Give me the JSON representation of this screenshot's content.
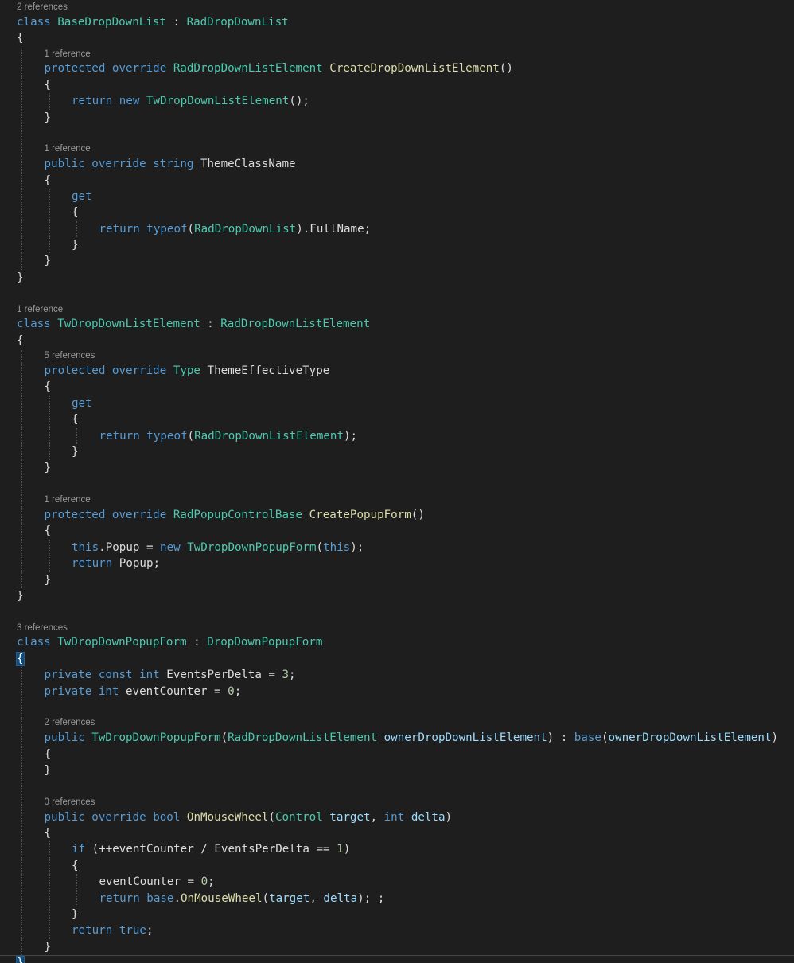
{
  "editor": {
    "language": "C#",
    "colors": {
      "background": "#1e1e1e",
      "keyword": "#569cd6",
      "type": "#4ec9b0",
      "method": "#dcdcaa",
      "parameter": "#9cdcfe",
      "number": "#b5cea8",
      "plain": "#dcdcdc",
      "codelens": "#999999"
    },
    "lines": [
      {
        "kind": "lens",
        "indent": 0,
        "text": "2 references"
      },
      {
        "kind": "code",
        "indent": 0,
        "tokens": [
          [
            "kw",
            "class"
          ],
          [
            "pl",
            " "
          ],
          [
            "ty",
            "BaseDropDownList"
          ],
          [
            "pl",
            " : "
          ],
          [
            "ty",
            "RadDropDownList"
          ]
        ]
      },
      {
        "kind": "code",
        "indent": 0,
        "tokens": [
          [
            "pl",
            "{"
          ]
        ]
      },
      {
        "kind": "lens",
        "indent": 1,
        "text": "1 reference"
      },
      {
        "kind": "code",
        "indent": 1,
        "tokens": [
          [
            "kw",
            "protected"
          ],
          [
            "pl",
            " "
          ],
          [
            "kw",
            "override"
          ],
          [
            "pl",
            " "
          ],
          [
            "ty",
            "RadDropDownListElement"
          ],
          [
            "pl",
            " "
          ],
          [
            "fn",
            "CreateDropDownListElement"
          ],
          [
            "pl",
            "()"
          ]
        ]
      },
      {
        "kind": "code",
        "indent": 1,
        "tokens": [
          [
            "pl",
            "{"
          ]
        ]
      },
      {
        "kind": "code",
        "indent": 2,
        "tokens": [
          [
            "kw",
            "return"
          ],
          [
            "pl",
            " "
          ],
          [
            "kw",
            "new"
          ],
          [
            "pl",
            " "
          ],
          [
            "ty",
            "TwDropDownListElement"
          ],
          [
            "pl",
            "();"
          ]
        ]
      },
      {
        "kind": "code",
        "indent": 1,
        "tokens": [
          [
            "pl",
            "}"
          ]
        ]
      },
      {
        "kind": "blank"
      },
      {
        "kind": "lens",
        "indent": 1,
        "text": "1 reference"
      },
      {
        "kind": "code",
        "indent": 1,
        "tokens": [
          [
            "kw",
            "public"
          ],
          [
            "pl",
            " "
          ],
          [
            "kw",
            "override"
          ],
          [
            "pl",
            " "
          ],
          [
            "kw",
            "string"
          ],
          [
            "pl",
            " ThemeClassName"
          ]
        ]
      },
      {
        "kind": "code",
        "indent": 1,
        "tokens": [
          [
            "pl",
            "{"
          ]
        ]
      },
      {
        "kind": "code",
        "indent": 2,
        "tokens": [
          [
            "kw",
            "get"
          ]
        ]
      },
      {
        "kind": "code",
        "indent": 2,
        "tokens": [
          [
            "pl",
            "{"
          ]
        ]
      },
      {
        "kind": "code",
        "indent": 3,
        "tokens": [
          [
            "kw",
            "return"
          ],
          [
            "pl",
            " "
          ],
          [
            "kw",
            "typeof"
          ],
          [
            "pl",
            "("
          ],
          [
            "ty",
            "RadDropDownList"
          ],
          [
            "pl",
            ").FullName;"
          ]
        ]
      },
      {
        "kind": "code",
        "indent": 2,
        "tokens": [
          [
            "pl",
            "}"
          ]
        ]
      },
      {
        "kind": "code",
        "indent": 1,
        "tokens": [
          [
            "pl",
            "}"
          ]
        ]
      },
      {
        "kind": "code",
        "indent": 0,
        "tokens": [
          [
            "pl",
            "}"
          ]
        ]
      },
      {
        "kind": "blank"
      },
      {
        "kind": "lens",
        "indent": 0,
        "text": "1 reference"
      },
      {
        "kind": "code",
        "indent": 0,
        "tokens": [
          [
            "kw",
            "class"
          ],
          [
            "pl",
            " "
          ],
          [
            "ty",
            "TwDropDownListElement"
          ],
          [
            "pl",
            " : "
          ],
          [
            "ty",
            "RadDropDownListElement"
          ]
        ]
      },
      {
        "kind": "code",
        "indent": 0,
        "tokens": [
          [
            "pl",
            "{"
          ]
        ]
      },
      {
        "kind": "lens",
        "indent": 1,
        "text": "5 references"
      },
      {
        "kind": "code",
        "indent": 1,
        "tokens": [
          [
            "kw",
            "protected"
          ],
          [
            "pl",
            " "
          ],
          [
            "kw",
            "override"
          ],
          [
            "pl",
            " "
          ],
          [
            "ty",
            "Type"
          ],
          [
            "pl",
            " ThemeEffectiveType"
          ]
        ]
      },
      {
        "kind": "code",
        "indent": 1,
        "tokens": [
          [
            "pl",
            "{"
          ]
        ]
      },
      {
        "kind": "code",
        "indent": 2,
        "tokens": [
          [
            "kw",
            "get"
          ]
        ]
      },
      {
        "kind": "code",
        "indent": 2,
        "tokens": [
          [
            "pl",
            "{"
          ]
        ]
      },
      {
        "kind": "code",
        "indent": 3,
        "tokens": [
          [
            "kw",
            "return"
          ],
          [
            "pl",
            " "
          ],
          [
            "kw",
            "typeof"
          ],
          [
            "pl",
            "("
          ],
          [
            "ty",
            "RadDropDownListElement"
          ],
          [
            "pl",
            ");"
          ]
        ]
      },
      {
        "kind": "code",
        "indent": 2,
        "tokens": [
          [
            "pl",
            "}"
          ]
        ]
      },
      {
        "kind": "code",
        "indent": 1,
        "tokens": [
          [
            "pl",
            "}"
          ]
        ]
      },
      {
        "kind": "blank"
      },
      {
        "kind": "lens",
        "indent": 1,
        "text": "1 reference"
      },
      {
        "kind": "code",
        "indent": 1,
        "tokens": [
          [
            "kw",
            "protected"
          ],
          [
            "pl",
            " "
          ],
          [
            "kw",
            "override"
          ],
          [
            "pl",
            " "
          ],
          [
            "ty",
            "RadPopupControlBase"
          ],
          [
            "pl",
            " "
          ],
          [
            "fn",
            "CreatePopupForm"
          ],
          [
            "pl",
            "()"
          ]
        ]
      },
      {
        "kind": "code",
        "indent": 1,
        "tokens": [
          [
            "pl",
            "{"
          ]
        ]
      },
      {
        "kind": "code",
        "indent": 2,
        "tokens": [
          [
            "kw",
            "this"
          ],
          [
            "pl",
            ".Popup = "
          ],
          [
            "kw",
            "new"
          ],
          [
            "pl",
            " "
          ],
          [
            "ty",
            "TwDropDownPopupForm"
          ],
          [
            "pl",
            "("
          ],
          [
            "kw",
            "this"
          ],
          [
            "pl",
            ");"
          ]
        ]
      },
      {
        "kind": "code",
        "indent": 2,
        "tokens": [
          [
            "kw",
            "return"
          ],
          [
            "pl",
            " Popup;"
          ]
        ]
      },
      {
        "kind": "code",
        "indent": 1,
        "tokens": [
          [
            "pl",
            "}"
          ]
        ]
      },
      {
        "kind": "code",
        "indent": 0,
        "tokens": [
          [
            "pl",
            "}"
          ]
        ]
      },
      {
        "kind": "blank"
      },
      {
        "kind": "lens",
        "indent": 0,
        "text": "3 references"
      },
      {
        "kind": "code",
        "indent": 0,
        "tokens": [
          [
            "kw",
            "class"
          ],
          [
            "pl",
            " "
          ],
          [
            "ty",
            "TwDropDownPopupForm"
          ],
          [
            "pl",
            " : "
          ],
          [
            "ty",
            "DropDownPopupForm"
          ]
        ]
      },
      {
        "kind": "code",
        "indent": 0,
        "brace": true,
        "tokens": [
          [
            "pl",
            "{"
          ]
        ]
      },
      {
        "kind": "code",
        "indent": 1,
        "tokens": [
          [
            "kw",
            "private"
          ],
          [
            "pl",
            " "
          ],
          [
            "kw",
            "const"
          ],
          [
            "pl",
            " "
          ],
          [
            "kw",
            "int"
          ],
          [
            "pl",
            " EventsPerDelta = "
          ],
          [
            "nm",
            "3"
          ],
          [
            "pl",
            ";"
          ]
        ]
      },
      {
        "kind": "code",
        "indent": 1,
        "tokens": [
          [
            "kw",
            "private"
          ],
          [
            "pl",
            " "
          ],
          [
            "kw",
            "int"
          ],
          [
            "pl",
            " eventCounter = "
          ],
          [
            "nm",
            "0"
          ],
          [
            "pl",
            ";"
          ]
        ]
      },
      {
        "kind": "blank"
      },
      {
        "kind": "lens",
        "indent": 1,
        "text": "2 references"
      },
      {
        "kind": "code",
        "indent": 1,
        "tokens": [
          [
            "kw",
            "public"
          ],
          [
            "pl",
            " "
          ],
          [
            "ty",
            "TwDropDownPopupForm"
          ],
          [
            "pl",
            "("
          ],
          [
            "ty",
            "RadDropDownListElement"
          ],
          [
            "pl",
            " "
          ],
          [
            "pr",
            "ownerDropDownListElement"
          ],
          [
            "pl",
            ") : "
          ],
          [
            "kw",
            "base"
          ],
          [
            "pl",
            "("
          ],
          [
            "pr",
            "ownerDropDownListElement"
          ],
          [
            "pl",
            ")"
          ]
        ]
      },
      {
        "kind": "code",
        "indent": 1,
        "tokens": [
          [
            "pl",
            "{"
          ]
        ]
      },
      {
        "kind": "code",
        "indent": 1,
        "tokens": [
          [
            "pl",
            "}"
          ]
        ]
      },
      {
        "kind": "blank"
      },
      {
        "kind": "lens",
        "indent": 1,
        "text": "0 references"
      },
      {
        "kind": "code",
        "indent": 1,
        "tokens": [
          [
            "kw",
            "public"
          ],
          [
            "pl",
            " "
          ],
          [
            "kw",
            "override"
          ],
          [
            "pl",
            " "
          ],
          [
            "kw",
            "bool"
          ],
          [
            "pl",
            " "
          ],
          [
            "fn",
            "OnMouseWheel"
          ],
          [
            "pl",
            "("
          ],
          [
            "ty",
            "Control"
          ],
          [
            "pl",
            " "
          ],
          [
            "pr",
            "target"
          ],
          [
            "pl",
            ", "
          ],
          [
            "kw",
            "int"
          ],
          [
            "pl",
            " "
          ],
          [
            "pr",
            "delta"
          ],
          [
            "pl",
            ")"
          ]
        ]
      },
      {
        "kind": "code",
        "indent": 1,
        "tokens": [
          [
            "pl",
            "{"
          ]
        ]
      },
      {
        "kind": "code",
        "indent": 2,
        "tokens": [
          [
            "kw",
            "if"
          ],
          [
            "pl",
            " (++eventCounter / EventsPerDelta == "
          ],
          [
            "nm",
            "1"
          ],
          [
            "pl",
            ")"
          ]
        ]
      },
      {
        "kind": "code",
        "indent": 2,
        "tokens": [
          [
            "pl",
            "{"
          ]
        ]
      },
      {
        "kind": "code",
        "indent": 3,
        "tokens": [
          [
            "pl",
            "eventCounter = "
          ],
          [
            "nm",
            "0"
          ],
          [
            "pl",
            ";"
          ]
        ]
      },
      {
        "kind": "code",
        "indent": 3,
        "tokens": [
          [
            "kw",
            "return"
          ],
          [
            "pl",
            " "
          ],
          [
            "kw",
            "base"
          ],
          [
            "pl",
            "."
          ],
          [
            "fn",
            "OnMouseWheel"
          ],
          [
            "pl",
            "("
          ],
          [
            "pr",
            "target"
          ],
          [
            "pl",
            ", "
          ],
          [
            "pr",
            "delta"
          ],
          [
            "pl",
            "); ;"
          ]
        ]
      },
      {
        "kind": "code",
        "indent": 2,
        "tokens": [
          [
            "pl",
            "}"
          ]
        ]
      },
      {
        "kind": "code",
        "indent": 2,
        "tokens": [
          [
            "kw",
            "return"
          ],
          [
            "pl",
            " "
          ],
          [
            "kw",
            "true"
          ],
          [
            "pl",
            ";"
          ]
        ]
      },
      {
        "kind": "code",
        "indent": 1,
        "tokens": [
          [
            "pl",
            "}"
          ]
        ]
      },
      {
        "kind": "code",
        "indent": 0,
        "brace": true,
        "current": true,
        "tokens": [
          [
            "pl",
            "}"
          ]
        ]
      }
    ]
  }
}
